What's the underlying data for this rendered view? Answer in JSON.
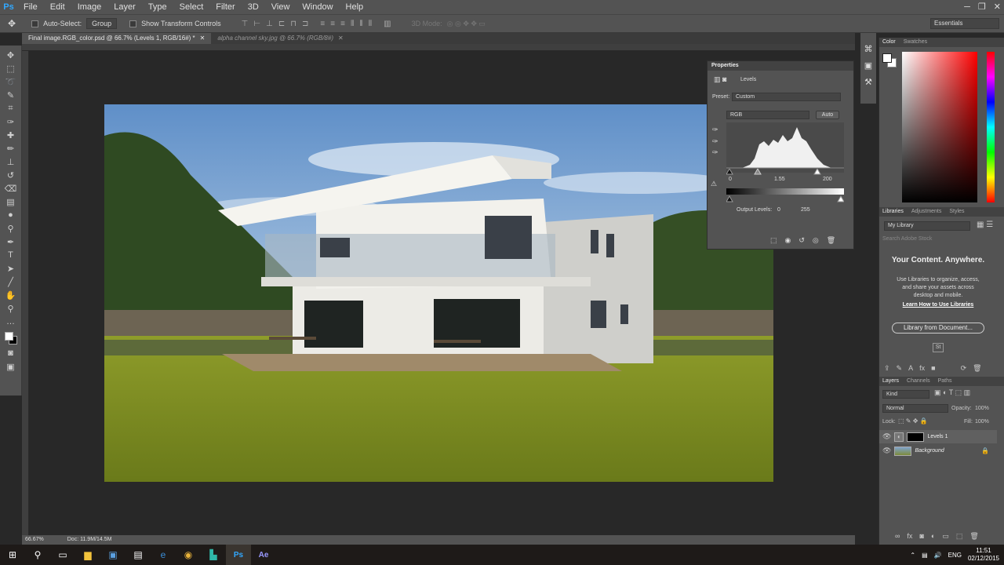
{
  "app": {
    "logo": "Ps",
    "menu": [
      "File",
      "Edit",
      "Image",
      "Layer",
      "Type",
      "Select",
      "Filter",
      "3D",
      "View",
      "Window",
      "Help"
    ],
    "window_controls": [
      "─",
      "❐",
      "✕"
    ]
  },
  "options_bar": {
    "auto_select_label": "Auto-Select:",
    "group_value": "Group",
    "show_transform_label": "Show Transform Controls",
    "mode_3d_label": "3D Mode:",
    "workspace": "Essentials"
  },
  "tabs": [
    {
      "label": "Final image.RGB_color.psd @ 66.7% (Levels 1, RGB/16#) *",
      "close": "✕"
    },
    {
      "label": "alpha channel sky.jpg @ 66.7% (RGB/8#)",
      "close": "✕"
    }
  ],
  "status": {
    "zoom": "66.67%",
    "doc": "Doc: 11.9M/14.5M"
  },
  "properties": {
    "title": "Properties",
    "adjustment": "Levels",
    "preset_label": "Preset:",
    "preset_value": "Custom",
    "channel": "RGB",
    "auto_button": "Auto",
    "input_black": "0",
    "input_gamma": "1.55",
    "input_white": "200",
    "output_label": "Output Levels:",
    "output_black": "0",
    "output_white": "255"
  },
  "color_panel": {
    "tabs": [
      "Color",
      "Swatches"
    ]
  },
  "libraries": {
    "tabs": [
      "Libraries",
      "Adjustments",
      "Styles"
    ],
    "library_select": "My Library",
    "search_placeholder": "Search Adobe Stock",
    "heading": "Your Content. Anywhere.",
    "description_lines": [
      "Use Libraries to organize, access,",
      "and share your assets across",
      "desktop and mobile."
    ],
    "learn_link": "Learn How to Use Libraries",
    "from_document_button": "Library from Document...",
    "stock_badge": "St"
  },
  "layers": {
    "tabs": [
      "Layers",
      "Channels",
      "Paths"
    ],
    "kind_filter": "Kind",
    "blend_mode": "Normal",
    "opacity_label": "Opacity:",
    "opacity_value": "100%",
    "lock_label": "Lock:",
    "fill_label": "Fill:",
    "fill_value": "100%",
    "items": [
      {
        "name": "Levels 1",
        "type": "adjustment"
      },
      {
        "name": "Background",
        "type": "image"
      }
    ]
  },
  "taskbar": {
    "lang": "ENG",
    "time": "11:51",
    "date": "02/12/2015"
  },
  "colors": {
    "panel": "#535353",
    "dark": "#282828",
    "ps_blue": "#31a8ff",
    "ae_purple": "#9999ff"
  }
}
